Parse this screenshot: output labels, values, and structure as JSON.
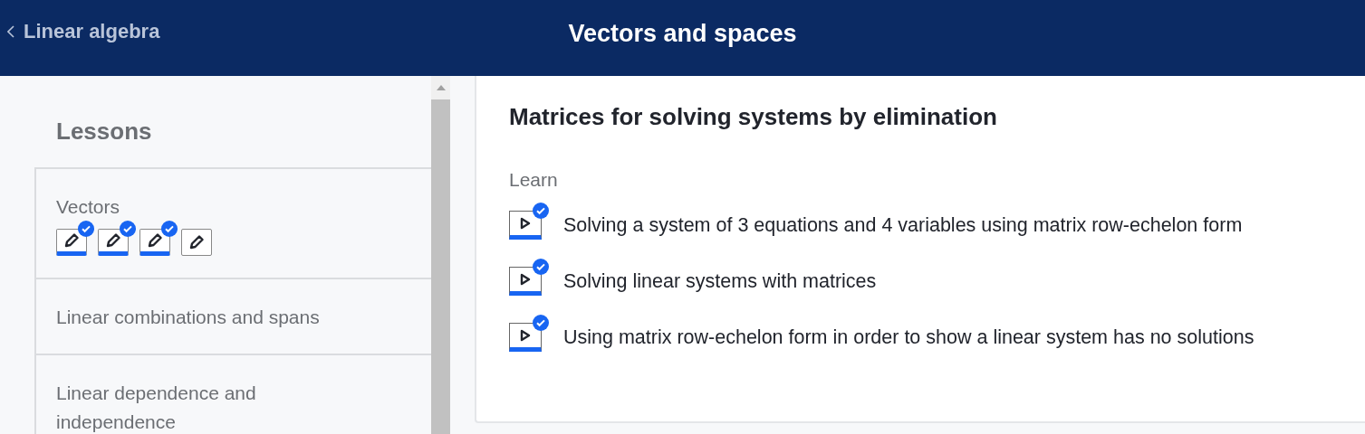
{
  "header": {
    "back_link": "Linear algebra",
    "title": "Vectors and spaces"
  },
  "sidebar": {
    "heading": "Lessons",
    "lessons": [
      {
        "title": "Vectors",
        "skills": [
          {
            "completed": true
          },
          {
            "completed": true
          },
          {
            "completed": true
          },
          {
            "completed": false
          }
        ]
      },
      {
        "title": "Linear combinations and spans"
      },
      {
        "title": "Linear dependence and independence"
      }
    ]
  },
  "content": {
    "title": "Matrices for solving systems by elimination",
    "section": "Learn",
    "videos": [
      {
        "title": "Solving a system of 3 equations and 4 variables using matrix row-echelon form",
        "completed": true
      },
      {
        "title": "Solving linear systems with matrices",
        "completed": true
      },
      {
        "title": "Using matrix row-echelon form in order to show a linear system has no solutions",
        "completed": true
      }
    ]
  }
}
